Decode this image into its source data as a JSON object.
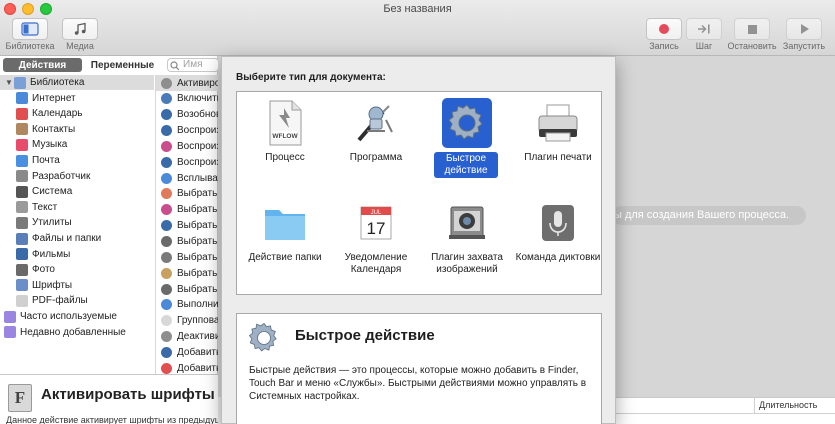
{
  "window": {
    "title": "Без названия"
  },
  "toolbar": {
    "library_label": "Библиотека",
    "media_label": "Медиа",
    "record_label": "Запись",
    "step_label": "Шаг",
    "stop_label": "Остановить",
    "run_label": "Запустить"
  },
  "library": {
    "tab_actions": "Действия",
    "tab_variables": "Переменные",
    "search_placeholder": "Имя",
    "items": [
      {
        "label": "Библиотека",
        "icon": "library-icon",
        "color": "#7aa0d8"
      },
      {
        "label": "Интернет",
        "icon": "internet-icon",
        "color": "#4a8ad8"
      },
      {
        "label": "Календарь",
        "icon": "calendar-icon",
        "color": "#e05050"
      },
      {
        "label": "Контакты",
        "icon": "contacts-icon",
        "color": "#b08860"
      },
      {
        "label": "Музыка",
        "icon": "music-icon",
        "color": "#e84c6c"
      },
      {
        "label": "Почта",
        "icon": "mail-icon",
        "color": "#4a90e2"
      },
      {
        "label": "Разработчик",
        "icon": "developer-icon",
        "color": "#8a8a8a"
      },
      {
        "label": "Система",
        "icon": "system-icon",
        "color": "#555555"
      },
      {
        "label": "Текст",
        "icon": "text-icon",
        "color": "#9a9a9a"
      },
      {
        "label": "Утилиты",
        "icon": "utilities-icon",
        "color": "#7a7a7a"
      },
      {
        "label": "Файлы и папки",
        "icon": "files-icon",
        "color": "#5a7fb8"
      },
      {
        "label": "Фильмы",
        "icon": "movies-icon",
        "color": "#3a6aa8"
      },
      {
        "label": "Фото",
        "icon": "photos-icon",
        "color": "#6a6a6a"
      },
      {
        "label": "Шрифты",
        "icon": "fonts-icon",
        "color": "#6a8fc8"
      },
      {
        "label": "PDF-файлы",
        "icon": "pdf-icon",
        "color": "#d0d0d0"
      },
      {
        "label": "Часто используемые",
        "icon": "smart-folder-icon",
        "color": "#9a86e0"
      },
      {
        "label": "Недавно добавленные",
        "icon": "smart-folder-icon",
        "color": "#9a86e0"
      }
    ],
    "actions": [
      {
        "label": "Активиро",
        "color": "#8e8e8e"
      },
      {
        "label": "Включить",
        "color": "#4a7ab8"
      },
      {
        "label": "Возобнов",
        "color": "#3a6aa8"
      },
      {
        "label": "Воспроиз",
        "color": "#3a6aa8"
      },
      {
        "label": "Воспроиз",
        "color": "#c84e8e"
      },
      {
        "label": "Воспроиз",
        "color": "#3a6aa8"
      },
      {
        "label": "Всплыва",
        "color": "#4a8ad8"
      },
      {
        "label": "Выбрать",
        "color": "#e07a5a"
      },
      {
        "label": "Выбрать",
        "color": "#c84e8e"
      },
      {
        "label": "Выбрать",
        "color": "#3a6aa8"
      },
      {
        "label": "Выбрать",
        "color": "#6a6a6a"
      },
      {
        "label": "Выбрать",
        "color": "#7a7a7a"
      },
      {
        "label": "Выбрать",
        "color": "#c8a060"
      },
      {
        "label": "Выбрать",
        "color": "#6a6a6a"
      },
      {
        "label": "Выполни",
        "color": "#4a8ad8"
      },
      {
        "label": "Группова",
        "color": "#d8d8d8"
      },
      {
        "label": "Деактиви",
        "color": "#8e8e8e"
      },
      {
        "label": "Добавить",
        "color": "#3a6aa8"
      },
      {
        "label": "Добавить",
        "color": "#e05050"
      },
      {
        "label": "Добавить",
        "color": "#4a8ad8"
      }
    ]
  },
  "description": {
    "title": "Активировать шрифты",
    "text": "Данное действие активирует шрифты из предыдущего действия."
  },
  "workflow": {
    "hint": "ы для создания Вашего процесса.",
    "log_duration_header": "Длительность"
  },
  "sheet": {
    "prompt": "Выберите тип для документа:",
    "types": [
      {
        "label": "Процесс",
        "icon": "workflow-file-icon",
        "icon_text": "WFLOW"
      },
      {
        "label": "Программа",
        "icon": "application-icon"
      },
      {
        "label": "Быстрое действие",
        "icon": "quick-action-gear-icon",
        "selected": true
      },
      {
        "label": "Плагин печати",
        "icon": "printer-icon"
      },
      {
        "label": "Действие папки",
        "icon": "folder-icon"
      },
      {
        "label": "Уведомление Календаря",
        "icon": "calendar-icon",
        "month": "JUL",
        "day": "17"
      },
      {
        "label": "Плагин захвата изображений",
        "icon": "camera-icon"
      },
      {
        "label": "Команда диктовки",
        "icon": "microphone-icon"
      }
    ],
    "detail": {
      "title": "Быстрое действие",
      "text": "Быстрые действия — это процессы, которые можно добавить в Finder, Touch Bar и меню «Службы». Быстрыми действиями можно управлять в Системных настройках."
    }
  },
  "colors": {
    "selection": "#2860cf",
    "record": "#e44b5b"
  }
}
